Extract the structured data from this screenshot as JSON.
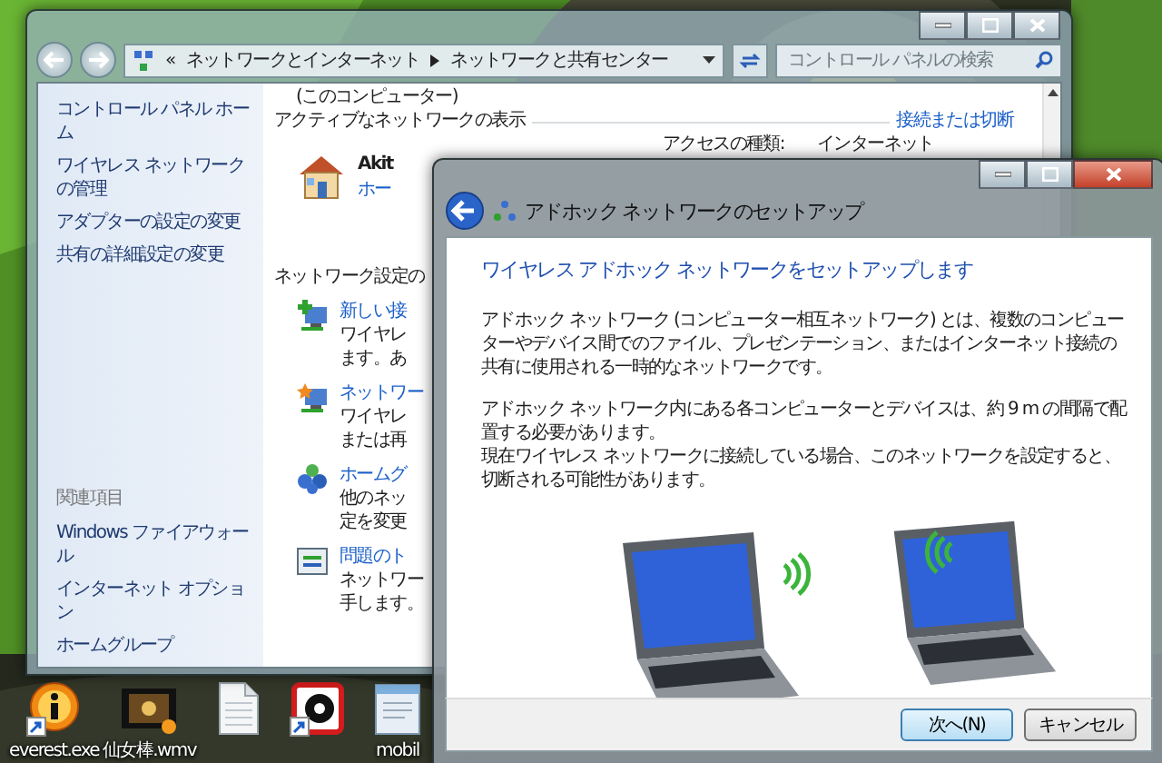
{
  "desktop": {
    "icons": [
      {
        "kind": "info",
        "label": "everest.exe",
        "shortcut": true
      },
      {
        "kind": "video",
        "label": "仙女棒.wmv",
        "shortcut": false
      },
      {
        "kind": "document",
        "shortcut": false
      },
      {
        "kind": "lens",
        "shortcut": true
      },
      {
        "kind": "window",
        "label": "mobil",
        "shortcut": false
      }
    ]
  },
  "control_panel": {
    "address": {
      "prefix": "«",
      "crumbs": [
        "ネットワークとインターネット",
        "ネットワークと共有センター"
      ]
    },
    "search": {
      "placeholder": "コントロール パネルの検索"
    },
    "sidebar": {
      "items": [
        "コントロール パネル ホーム",
        "ワイヤレス ネットワークの管理",
        "アダプターの設定の変更",
        "共有の詳細設定の変更"
      ],
      "related_heading": "関連項目",
      "related_items": [
        "Windows ファイアウォール",
        "インターネット オプション",
        "ホームグループ"
      ]
    },
    "content": {
      "caption": "(このコンピューター)",
      "active_heading": "アクティブなネットワークの表示",
      "connect_link": "接続または切断",
      "network": {
        "name": "Akit",
        "link": "ホー",
        "access_label": "アクセスの種類:",
        "access_value": "インターネット"
      },
      "settings_heading": "ネットワーク設定の",
      "tasks": [
        {
          "kind": "new-connection",
          "title": "新しい接",
          "lines": [
            "ワイヤレ",
            "ます。あ"
          ]
        },
        {
          "kind": "connect",
          "title": "ネットワー",
          "lines": [
            "ワイヤレ",
            "または再"
          ]
        },
        {
          "kind": "homegroup",
          "title": "ホームグ",
          "lines": [
            "他のネッ",
            "定を変更"
          ]
        },
        {
          "kind": "troubleshoot",
          "title": "問題のト",
          "lines": [
            "ネットワー",
            "手します。"
          ]
        }
      ]
    }
  },
  "dialog": {
    "title": "アドホック ネットワークのセットアップ",
    "heading": "ワイヤレス アドホック ネットワークをセットアップします",
    "paragraphs": [
      "アドホック ネットワーク (コンピューター相互ネットワーク) とは、複数のコンピューターやデバイス間でのファイル、プレゼンテーション、またはインターネット接続の共有に使用される一時的なネットワークです。",
      "アドホック ネットワーク内にある各コンピューターとデバイスは、約 9 m の間隔で配置する必要があります。",
      "現在ワイヤレス ネットワークに接続している場合、このネットワークを設定すると、切断される可能性があります。"
    ],
    "buttons": [
      {
        "label": "次へ(N)",
        "default": true
      },
      {
        "label": "キャンセル",
        "default": false
      }
    ]
  }
}
